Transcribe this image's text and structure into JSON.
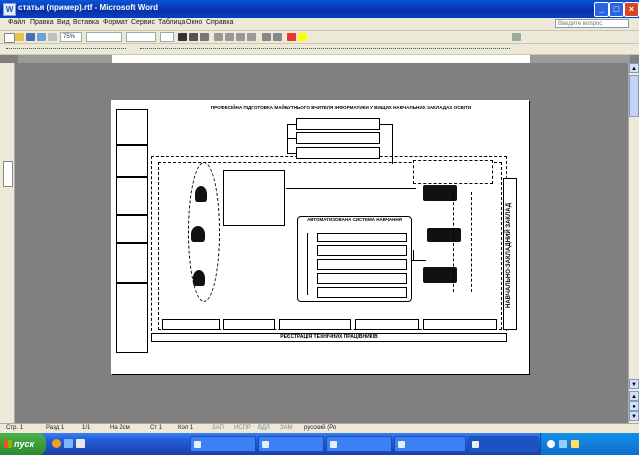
{
  "window": {
    "title": "статья (пример).rtf - Microsoft Word",
    "minimize": "_",
    "maximize": "□",
    "close": "×"
  },
  "menu": {
    "items": [
      "Файл",
      "Правка",
      "Вид",
      "Вставка",
      "Формат",
      "Сервис",
      "Таблица",
      "Окно",
      "Справка"
    ],
    "help_placeholder": "Введите вопрос"
  },
  "toolbar": {
    "zoom": "75%",
    "style": "",
    "font": "",
    "size": ""
  },
  "diagram": {
    "title": "ПРОФЕСІЙНА ПІДГОТОВКА МАЙБУТНЬОГО ВЧИТЕЛЯ ІНФОРМАТИКИ У ВИЩИХ НАВЧАЛЬНИХ ЗАКЛАДАХ ОСВІТИ",
    "right_vertical": "НАВЧАЛЬНО-ЗАКЛАДНИЙ ЗАКЛАД",
    "bottom_bar": "РЕЄСТРАЦІЯ ТЕХНІЧНИХ ПРАЦІВНИКІВ",
    "left_boxes": [
      "",
      "",
      "",
      "",
      "",
      ""
    ],
    "center_box_a": "",
    "center_box_b": "",
    "center_box_c": "",
    "auto_system_title": "АВТОМАТИЗОВАНА СИСТЕМА НАВЧАННЯ",
    "auto_system_rows": [
      "",
      "",
      "",
      "",
      ""
    ],
    "top_boxes": [
      "",
      "",
      ""
    ],
    "right_group_title": "",
    "bottom_cells": [
      "",
      "",
      "",
      "",
      ""
    ],
    "caption": "",
    "figure_labels": [
      "",
      "",
      ""
    ]
  },
  "statusbar": {
    "items": [
      "Стр. 1",
      "Разд 1",
      "1/1",
      "На 2см",
      "Ст 1",
      "Кол 1",
      "ЗАП",
      "ИСПР",
      "ВДЛ",
      "ЗАМ",
      "русский (Ро"
    ]
  },
  "taskbar": {
    "start": "пуск",
    "tasks": [
      "",
      "",
      "",
      "",
      ""
    ],
    "clock": ""
  }
}
